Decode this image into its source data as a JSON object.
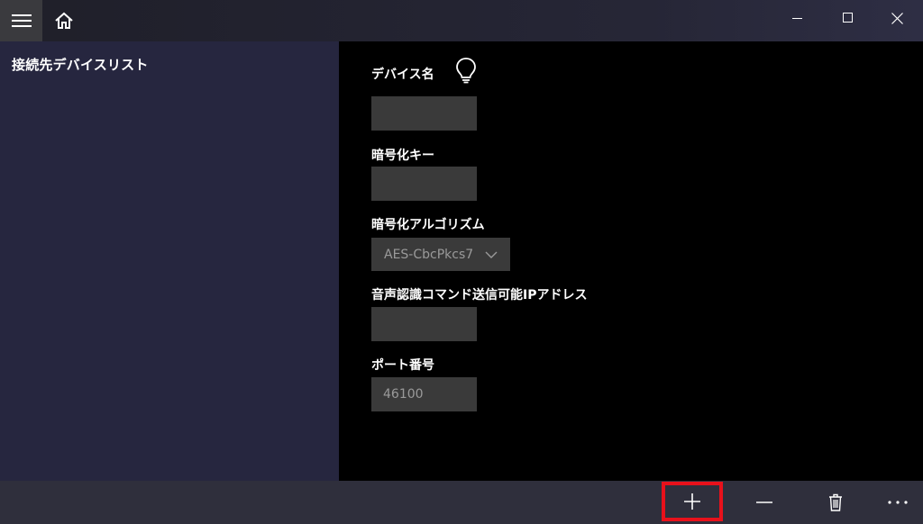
{
  "titlebar": {
    "menu_icon": "hamburger-icon",
    "home_icon": "home-icon",
    "window_controls": [
      "minimize-icon",
      "maximize-icon",
      "close-icon"
    ]
  },
  "sidebar": {
    "title": "接続先デバイスリスト"
  },
  "form": {
    "device_name_label": "デバイス名",
    "device_name_value": "",
    "encryption_key_label": "暗号化キー",
    "encryption_key_value": "",
    "algorithm_label": "暗号化アルゴリズム",
    "algorithm_value": "AES-CbcPkcs7",
    "ip_label": "音声認識コマンド送信可能IPアドレス",
    "ip_value": "",
    "port_label": "ポート番号",
    "port_value": "46100"
  },
  "appbar": {
    "buttons": [
      "add-icon",
      "remove-icon",
      "delete-icon",
      "more-icon"
    ],
    "highlight_color": "#e8111b"
  }
}
